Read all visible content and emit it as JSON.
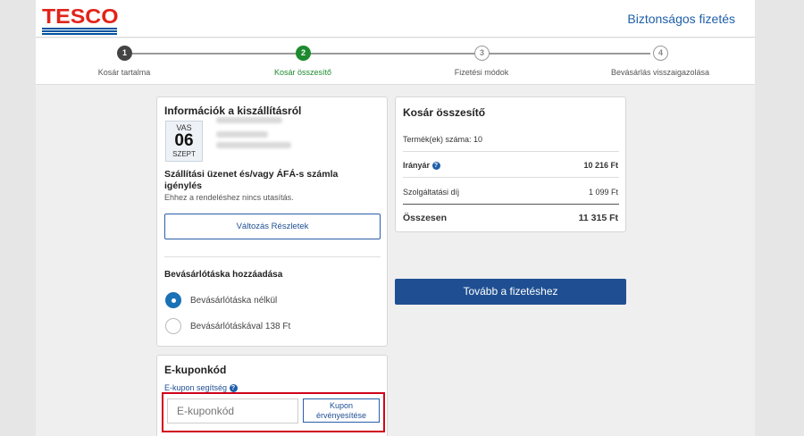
{
  "header": {
    "logo_text": "TESCO",
    "secure_checkout": "Biztonságos fizetés"
  },
  "stepper": {
    "steps": [
      {
        "number": "1",
        "label": "Kosár tartalma",
        "state": "done"
      },
      {
        "number": "2",
        "label": "Kosár összesítő",
        "state": "active"
      },
      {
        "number": "3",
        "label": "Fizetési módok",
        "state": "todo"
      },
      {
        "number": "4",
        "label": "Bevásárlás visszaigazolása",
        "state": "todo"
      }
    ]
  },
  "delivery": {
    "title": "Információk a kiszállításról",
    "date": {
      "dow": "VAS",
      "day": "06",
      "month": "SZEPT"
    },
    "message_title": "Szállítási üzenet és/vagy ÁFÁ-s számla igénylés",
    "message_note": "Ehhez a rendeléshez nincs utasítás.",
    "change_details_button": "Változás Részletek",
    "bag_title": "Bevásárlótáska hozzáadása",
    "bag_options": [
      {
        "label": "Bevásárlótáska nélkül",
        "selected": true
      },
      {
        "label": "Bevásárlótáskával 138 Ft",
        "selected": false
      }
    ]
  },
  "coupon": {
    "title": "E-kuponkód",
    "help_link": "E-kupon segítség",
    "input_placeholder": "E-kuponkód",
    "apply_button_line1": "Kupon",
    "apply_button_line2": "érvényesítése"
  },
  "summary": {
    "title": "Kosár összesítő",
    "items_label": "Termék(ek) száma:",
    "items_value": "10",
    "rows": [
      {
        "label": "Irányár",
        "value": "10 216 Ft",
        "bold": true,
        "help": true
      },
      {
        "label": "Szolgáltatási díj",
        "value": "1 099 Ft",
        "bold": false,
        "help": false
      },
      {
        "label": "Összesen",
        "value": "11 315 Ft",
        "bold": true,
        "help": false
      }
    ]
  },
  "continue_button": "Tovább a fizetéshez",
  "colors": {
    "brand_red": "#e2231a",
    "brand_blue": "#00539f",
    "active_green": "#1d8a2e",
    "highlight_red": "#d0021b"
  }
}
